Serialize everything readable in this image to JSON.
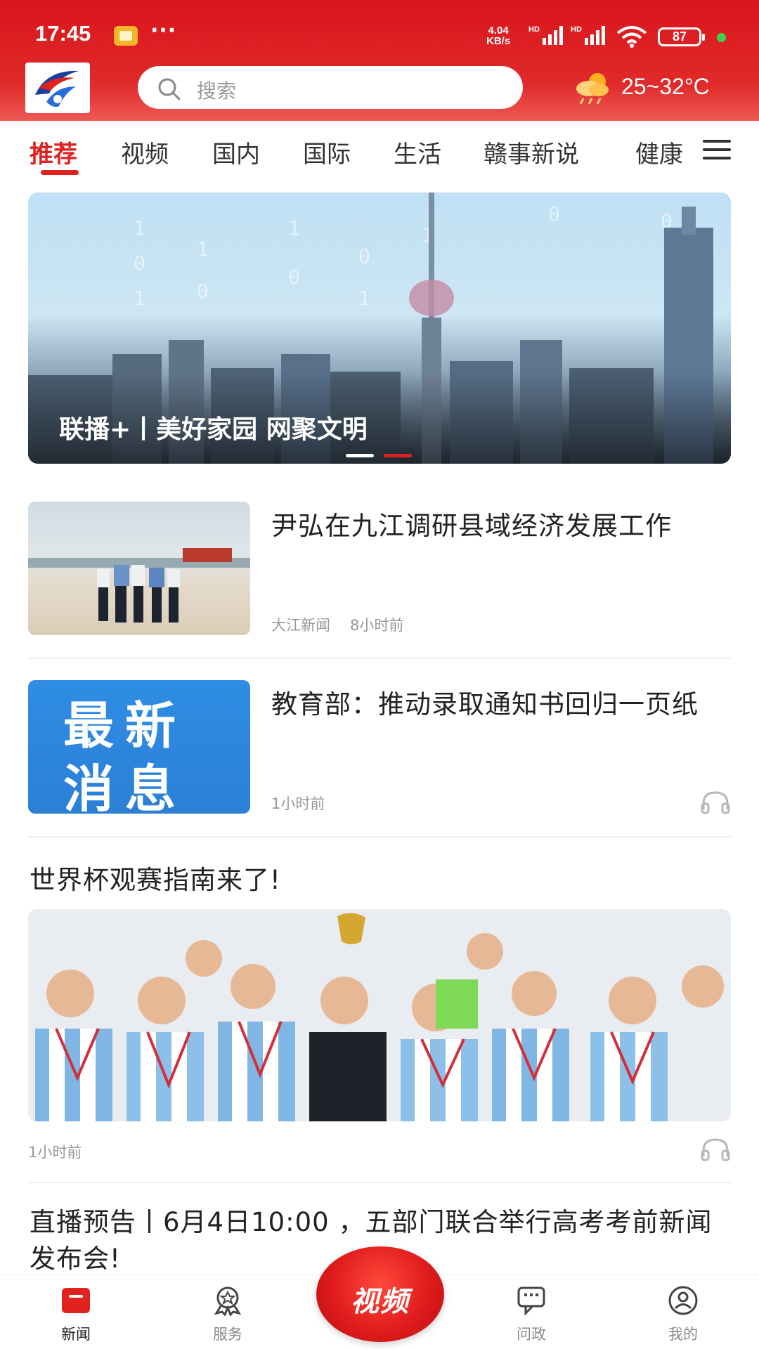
{
  "status_bar": {
    "time": "17:45",
    "dots": "···",
    "net_speed_value": "4.04",
    "net_speed_unit": "KB/s",
    "sim1_label": "HD",
    "sim2_label": "HD",
    "battery": "87"
  },
  "header": {
    "search_placeholder": "搜索",
    "weather_icon": "cloud-sun-rain-icon",
    "weather": "25~32°C"
  },
  "tabs": [
    {
      "label": "推荐",
      "active": true
    },
    {
      "label": "视频"
    },
    {
      "label": "国内"
    },
    {
      "label": "国际"
    },
    {
      "label": "生活"
    },
    {
      "label": "赣事新说"
    },
    {
      "label": "健康"
    }
  ],
  "banner": {
    "title": "联播+丨美好家园 网聚文明",
    "slides": 2,
    "active_slide": 2
  },
  "news": [
    {
      "title": "尹弘在九江调研县域经济发展工作",
      "source": "大江新闻",
      "time": "8小时前"
    },
    {
      "title": "教育部：推动录取通知书回归一页纸",
      "thumb_line1": "最新",
      "thumb_line2": "消息",
      "time": "1小时前"
    }
  ],
  "feature": {
    "title": "世界杯观赛指南来了!",
    "time": "1小时前"
  },
  "live": {
    "title": "直播预告丨6月4日10:00 ，五部门联合举行高考考前新闻发布会!"
  },
  "bottom_nav": {
    "items": [
      {
        "label": "新闻",
        "icon": "news-icon",
        "active": true
      },
      {
        "label": "服务",
        "icon": "service-icon"
      },
      {
        "label": "问政",
        "icon": "chat-icon"
      },
      {
        "label": "我的",
        "icon": "user-icon"
      }
    ],
    "video_button": "视频"
  },
  "colors": {
    "brand_red": "#e0231f",
    "header_red": "#d9151b"
  }
}
